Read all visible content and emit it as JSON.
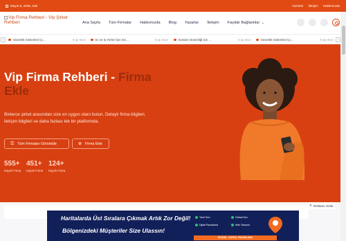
{
  "topbar": {
    "date": "Mayıs 5, 2026, Salı",
    "links": [
      "Yazarlar",
      "İletişim",
      "Hakkımızda"
    ]
  },
  "header": {
    "logo_alt": "Vip Firma Rehberi - Vip Şirket Rehberi",
    "nav": [
      "Ana Sayfa",
      "Tüm Firmalar",
      "Hakkımızda",
      "Blog",
      "Yazarlar",
      "İletişim",
      "Faydalı Bağlantılar"
    ],
    "icons": [
      "moon-icon",
      "search-icon",
      "user-icon",
      "settings-icon"
    ]
  },
  "ticker": {
    "items": [
      {
        "title": "Güvenlik Sistemleri İçi…",
        "time": "5 ay önce"
      },
      {
        "title": "Ev ve İş Yerleri İçin Gü…",
        "time": "5 ay önce"
      },
      {
        "title": "Evinizin Güvenliği İçin …",
        "time": "5 ay önce"
      },
      {
        "title": "Güvenlik Sistemleri İçi…",
        "time": "5 ay önce"
      }
    ]
  },
  "hero": {
    "title_a": "Vip Firma Rehberi - ",
    "title_b": "Firma",
    "title_c": "Ekle",
    "desc_1": "Binlerce şirket arasından size en uygun olanı bulun. Detaylı firma bilgileri,",
    "desc_2": "iletişim bilgileri ve daha fazlası tek bir platformda.",
    "btn_list": "Tüm Firmaları Görüntüle",
    "btn_add": "Firma Ekle",
    "stats": [
      {
        "num": "555+",
        "label": "Kayıtlı Firma"
      },
      {
        "num": "451+",
        "label": "Kayıtlı Firma"
      },
      {
        "num": "124+",
        "label": "Kayıtlı Firma"
      }
    ]
  },
  "ad": {
    "close_label": "Reklamı Gizle",
    "line1": "Haritalarda Üst Sıralara Çıkmak Artık Zor Değil!",
    "line2": "Bölgenizdeki Müşteriler Size Ulassın!",
    "features": [
      "Yerel Seo",
      "Global Seo",
      "Dijital Pazarlama",
      "Web Tasarım"
    ],
    "pill": "EDS2ID - DİJİTAL PAZARLAMA"
  },
  "colors": {
    "brand": "#e14a12",
    "hero_bg": "#d84011",
    "highlight": "#9c2c0a",
    "banner_bg": "#12205a"
  }
}
